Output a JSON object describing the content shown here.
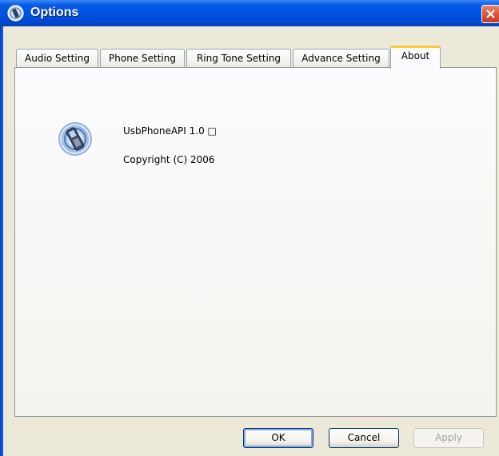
{
  "window": {
    "title": "Options",
    "app_icon": "phone-app-icon",
    "close_icon": "close-icon"
  },
  "tabs": [
    {
      "label": "Audio Setting",
      "active": false
    },
    {
      "label": "Phone Setting",
      "active": false
    },
    {
      "label": "Ring Tone Setting",
      "active": false
    },
    {
      "label": "Advance Setting",
      "active": false
    },
    {
      "label": "About",
      "active": true
    }
  ],
  "about": {
    "icon": "phone-signal-icon",
    "product": "UsbPhoneAPI 1.0 □",
    "copyright": "Copyright (C) 2006"
  },
  "buttons": {
    "ok": "OK",
    "cancel": "Cancel",
    "apply": "Apply"
  },
  "colors": {
    "titlebar": "#0054e3",
    "active_tab_accent": "#ffc83c",
    "close_button": "#d9583c"
  }
}
